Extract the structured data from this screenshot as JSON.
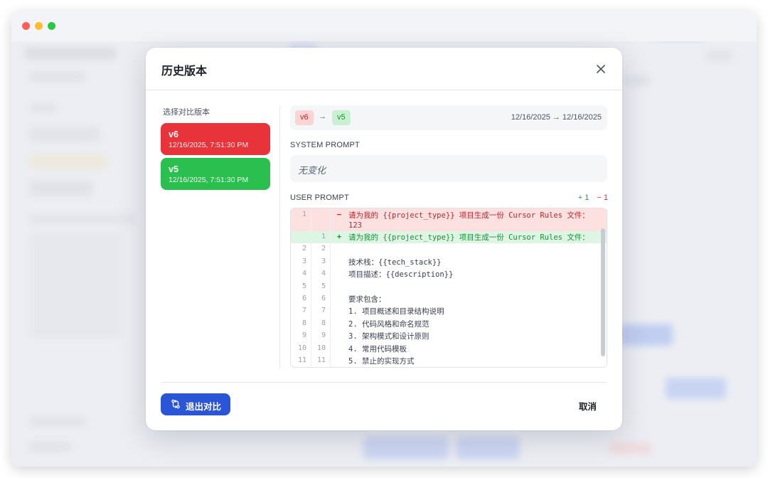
{
  "window": {
    "controls": [
      "close",
      "minimize",
      "maximize"
    ]
  },
  "modal": {
    "title": "历史版本",
    "close_icon": "close-icon",
    "versions_label": "选择对比版本",
    "versions": [
      {
        "name": "v6",
        "time": "12/16/2025, 7:51:30 PM",
        "color": "#e8333b"
      },
      {
        "name": "v5",
        "time": "12/16/2025, 7:51:30 PM",
        "color": "#2bbf4f"
      }
    ],
    "compare": {
      "from": "v6",
      "arrow": "→",
      "to": "v5",
      "dates": "12/16/2025 → 12/16/2025"
    },
    "system_prompt": {
      "label": "SYSTEM PROMPT",
      "content": "无变化"
    },
    "user_prompt": {
      "label": "USER PROMPT",
      "added": "+ 1",
      "removed": "− 1",
      "lines": [
        {
          "type": "del",
          "old": "1",
          "new": "",
          "mark": "−",
          "text": "请为我的 {{project_type}} 项目生成一份 Cursor Rules 文件：123"
        },
        {
          "type": "add",
          "old": "",
          "new": "1",
          "mark": "+",
          "text": "请为我的 {{project_type}} 项目生成一份 Cursor Rules 文件："
        },
        {
          "type": "ctx",
          "old": "2",
          "new": "2",
          "mark": "",
          "text": ""
        },
        {
          "type": "ctx",
          "old": "3",
          "new": "3",
          "mark": "",
          "text": "技术栈：{{tech_stack}}"
        },
        {
          "type": "ctx",
          "old": "4",
          "new": "4",
          "mark": "",
          "text": "项目描述：{{description}}"
        },
        {
          "type": "ctx",
          "old": "5",
          "new": "5",
          "mark": "",
          "text": ""
        },
        {
          "type": "ctx",
          "old": "6",
          "new": "6",
          "mark": "",
          "text": "要求包含："
        },
        {
          "type": "ctx",
          "old": "7",
          "new": "7",
          "mark": "",
          "text": "1. 项目概述和目录结构说明"
        },
        {
          "type": "ctx",
          "old": "8",
          "new": "8",
          "mark": "",
          "text": "2. 代码风格和命名规范"
        },
        {
          "type": "ctx",
          "old": "9",
          "new": "9",
          "mark": "",
          "text": "3. 架构模式和设计原则"
        },
        {
          "type": "ctx",
          "old": "10",
          "new": "10",
          "mark": "",
          "text": "4. 常用代码模板"
        },
        {
          "type": "ctx",
          "old": "11",
          "new": "11",
          "mark": "",
          "text": "5. 禁止的实现方式"
        }
      ]
    },
    "footer": {
      "exit_label": "退出对比",
      "exit_icon": "git-compare-icon",
      "cancel_label": "取消"
    }
  },
  "colors": {
    "primary": "#2a55d6",
    "danger": "#e8333b",
    "success": "#2bbf4f"
  }
}
